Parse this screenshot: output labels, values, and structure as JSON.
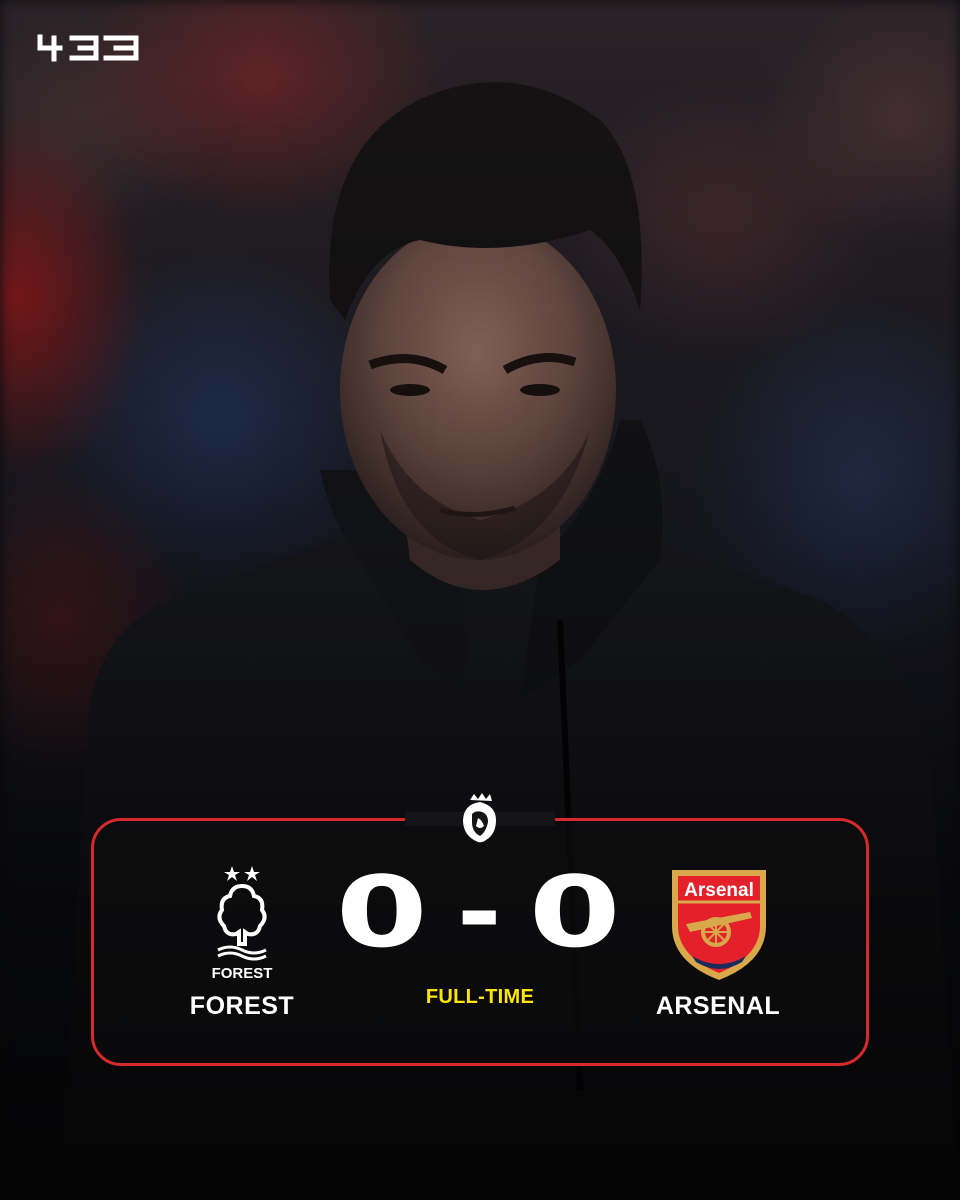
{
  "brand": {
    "logo_text": "433"
  },
  "competition": {
    "icon": "premier-league-lion-icon"
  },
  "match": {
    "home_team": "FOREST",
    "away_team": "ARSENAL",
    "home_score": "0",
    "separator": "-",
    "away_score": "0",
    "status": "FULL-TIME"
  },
  "crests": {
    "home": {
      "icon": "nottingham-forest-crest-icon",
      "wordmark": "FOREST"
    },
    "away": {
      "icon": "arsenal-crest-icon",
      "wordmark": "Arsenal"
    }
  },
  "colors": {
    "card_border": "#d42a2a",
    "status_text": "#ffe600",
    "arsenal_red": "#e4202a",
    "arsenal_gold": "#d8a84a",
    "arsenal_navy": "#1a2b5c"
  }
}
